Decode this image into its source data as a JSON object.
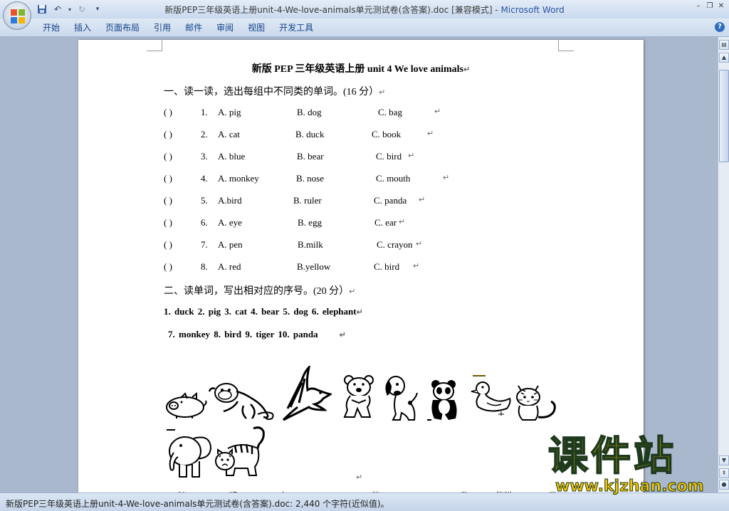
{
  "window": {
    "title": "新版PEP三年级英语上册unit-4-We-love-animals单元测试卷(含答案).doc [兼容模式]",
    "app_name": "Microsoft Word",
    "separator": " - "
  },
  "ribbon": {
    "tabs": [
      "开始",
      "插入",
      "页面布局",
      "引用",
      "邮件",
      "审阅",
      "视图",
      "开发工具"
    ]
  },
  "document": {
    "title": "新版 PEP 三年级英语上册 unit 4 We love animals",
    "section1": "一、读一读，选出每组中不同类的单词。(16 分）",
    "questions": [
      {
        "paren": "(      )",
        "num": "1.",
        "a": "A. pig",
        "b": "B. dog",
        "c": "C. bag"
      },
      {
        "paren": "(      )",
        "num": "2.",
        "a": "A. cat",
        "b": "B. duck",
        "c": "C. book"
      },
      {
        "paren": "(      )",
        "num": "3.",
        "a": "A. blue",
        "b": "B. bear",
        "c": "C. bird"
      },
      {
        "paren": "(      )",
        "num": "4.",
        "a": "A. monkey",
        "b": "B. nose",
        "c": "C. mouth"
      },
      {
        "paren": "(      )",
        "num": "5.",
        "a": "A.bird",
        "b": "B. ruler",
        "c": "C. panda"
      },
      {
        "paren": "(      )",
        "num": "6.",
        "a": "A. eye",
        "b": "B. egg",
        "c": "C. ear"
      },
      {
        "paren": "(      )",
        "num": "7.",
        "a": "A. pen",
        "b": "B.milk",
        "c": "C. crayon"
      },
      {
        "paren": "(      )",
        "num": "8.",
        "a": "A. red",
        "b": "B.yellow",
        "c": "C. bird"
      }
    ],
    "section2": "二、读单词，写出相对应的序号。(20 分）",
    "words_line1": "1. duck    2. pig    3. cat     4. bear     5. dog     6. elephant",
    "words_line2": "7. monkey     8. bird    9. tiger    10. panda",
    "paragraph_mark": "↵",
    "animals": [
      "pig-icon",
      "monkey-icon",
      "bird-icon",
      "bear-icon",
      "dog-icon",
      "panda-icon",
      "duck-icon",
      "cat-icon",
      "elephant-icon",
      "tiger-icon"
    ],
    "bottom_chars": [
      "猪",
      "猴",
      "鸟",
      "熊",
      "狗",
      "熊猫",
      "鸭",
      "子"
    ]
  },
  "statusbar": {
    "text": "新版PEP三年级英语上册unit-4-We-love-animals单元测试卷(含答案).doc: 2,440 个字符(近似值)。"
  },
  "watermark": {
    "cn": "课件站",
    "url": "www.kjzhan.com"
  }
}
